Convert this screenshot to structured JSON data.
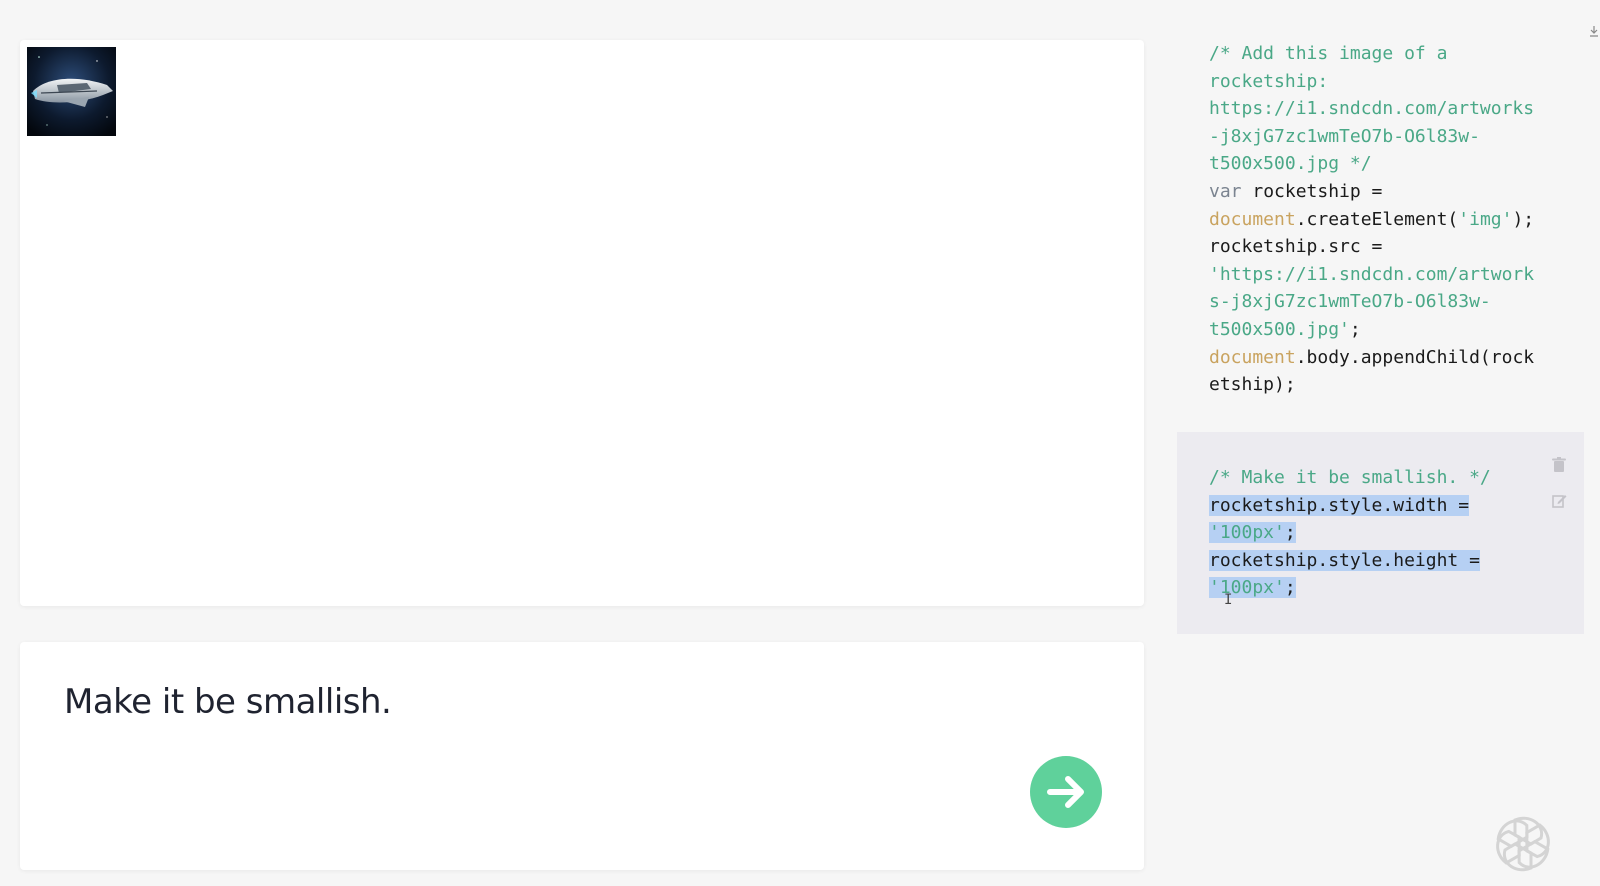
{
  "prompt": {
    "text": "Make it be smallish."
  },
  "code_block_1": {
    "lines": [
      [
        {
          "t": "/* Add this image of a",
          "c": "c-comment"
        }
      ],
      [
        {
          "t": "rocketship:",
          "c": "c-comment"
        }
      ],
      [
        {
          "t": "https://i1.sndcdn.com/artworks",
          "c": "c-comment"
        }
      ],
      [
        {
          "t": "-j8xjG7zc1wmTeO7b-O6l83w-",
          "c": "c-comment"
        }
      ],
      [
        {
          "t": "t500x500.jpg */",
          "c": "c-comment"
        }
      ],
      [
        {
          "t": "var",
          "c": "c-kw"
        },
        {
          "t": " rocketship =",
          "c": ""
        }
      ],
      [
        {
          "t": "document",
          "c": "c-global"
        },
        {
          "t": ".createElement(",
          "c": ""
        },
        {
          "t": "'img'",
          "c": "c-str"
        },
        {
          "t": ");",
          "c": ""
        }
      ],
      [
        {
          "t": "rocketship.src =",
          "c": ""
        }
      ],
      [
        {
          "t": "'https://i1.sndcdn.com/artwork",
          "c": "c-str"
        }
      ],
      [
        {
          "t": "s-j8xjG7zc1wmTeO7b-O6l83w-",
          "c": "c-str"
        }
      ],
      [
        {
          "t": "t500x500.jpg'",
          "c": "c-str"
        },
        {
          "t": ";",
          "c": ""
        }
      ],
      [
        {
          "t": "document",
          "c": "c-global"
        },
        {
          "t": ".body.appendChild(rock",
          "c": ""
        }
      ],
      [
        {
          "t": "etship);",
          "c": ""
        }
      ]
    ]
  },
  "code_block_2": {
    "lines": [
      [
        {
          "t": "/* Make it be smallish. */",
          "c": "c-comment"
        }
      ],
      [
        {
          "t": "rocketship.style.width =",
          "c": "",
          "sel": true
        }
      ],
      [
        {
          "t": "'100px'",
          "c": "c-str",
          "sel": true
        },
        {
          "t": ";",
          "c": "",
          "sel": true
        }
      ],
      [
        {
          "t": "rocketship.style.height =",
          "c": "",
          "sel": true
        }
      ],
      [
        {
          "t": "'100px'",
          "c": "c-str",
          "sel": true
        },
        {
          "t": ";",
          "c": "",
          "sel": true
        }
      ]
    ]
  },
  "icons": {
    "trash": "trash-icon",
    "edit": "edit-icon",
    "submit": "arrow-right-icon",
    "logo": "openai-logo-icon",
    "image": "rocketship-image"
  },
  "colors": {
    "submit_button": "#5fd19b",
    "comment": "#4aa887",
    "keyword": "#7b8490",
    "global": "#c9a35f",
    "selection": "#b6d0f3"
  }
}
